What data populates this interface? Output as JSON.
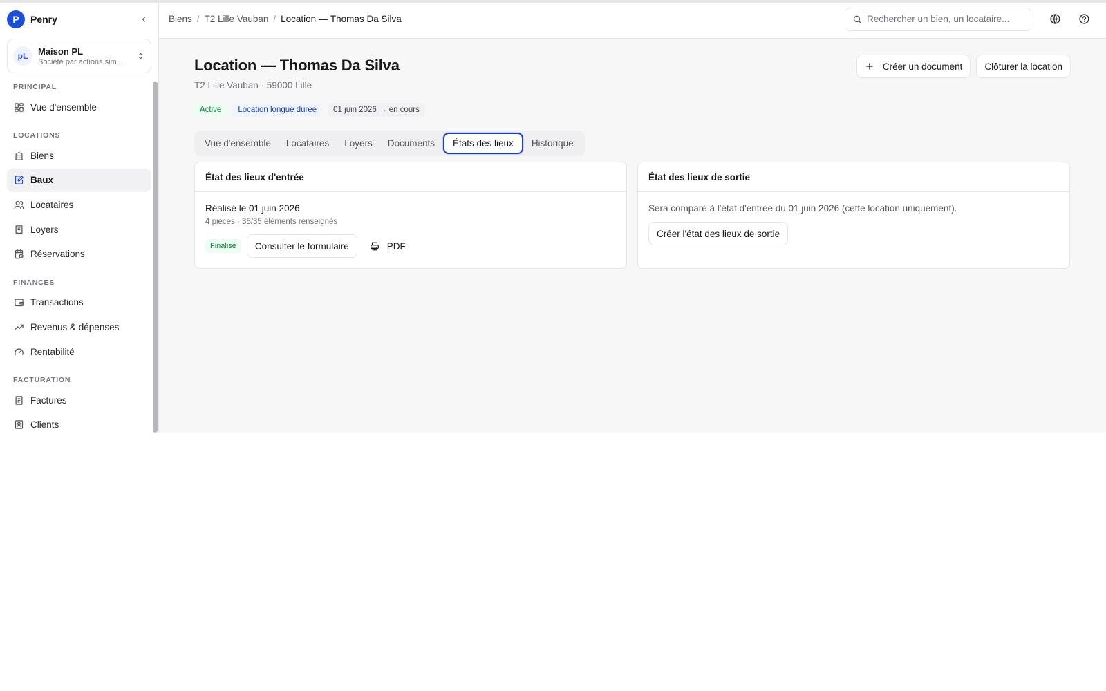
{
  "brand": {
    "logo_letter": "P",
    "name": "Penry"
  },
  "org": {
    "initials": "pL",
    "name": "Maison PL",
    "type": "Société par actions sim..."
  },
  "sidebar": {
    "sections": [
      {
        "title": "PRINCIPAL",
        "items": [
          {
            "label": "Vue d'ensemble",
            "icon": "dashboard-icon"
          }
        ]
      },
      {
        "title": "LOCATIONS",
        "items": [
          {
            "label": "Biens",
            "icon": "building-icon"
          },
          {
            "label": "Baux",
            "icon": "lease-edit-icon",
            "active": true
          },
          {
            "label": "Locataires",
            "icon": "users-icon"
          },
          {
            "label": "Loyers",
            "icon": "receipt-icon"
          },
          {
            "label": "Réservations",
            "icon": "calendar-clock-icon"
          }
        ]
      },
      {
        "title": "FINANCES",
        "items": [
          {
            "label": "Transactions",
            "icon": "wallet-icon"
          },
          {
            "label": "Revenus & dépenses",
            "icon": "trending-up-icon"
          },
          {
            "label": "Rentabilité",
            "icon": "gauge-icon"
          }
        ]
      },
      {
        "title": "FACTURATION",
        "items": [
          {
            "label": "Factures",
            "icon": "invoice-icon"
          },
          {
            "label": "Clients",
            "icon": "contact-icon"
          }
        ]
      }
    ]
  },
  "breadcrumb": [
    "Biens",
    "T2 Lille Vauban",
    "Location — Thomas Da Silva"
  ],
  "search": {
    "placeholder": "Rechercher un bien, un locataire..."
  },
  "page": {
    "title": "Location — Thomas Da Silva",
    "subtitle": "T2 Lille Vauban · 59000 Lille",
    "badges": {
      "status": "Active",
      "type": "Location longue durée",
      "period": "01 juin 2026 → en cours"
    },
    "actions": {
      "create_doc": "Créer un document",
      "close_lease": "Clôturer la location"
    }
  },
  "tabs": [
    {
      "label": "Vue d'ensemble"
    },
    {
      "label": "Locataires"
    },
    {
      "label": "Loyers"
    },
    {
      "label": "Documents"
    },
    {
      "label": "États des lieux",
      "active": true
    },
    {
      "label": "Historique"
    }
  ],
  "entry_card": {
    "title": "État des lieux d'entrée",
    "done": "Réalisé le 01 juin 2026",
    "meta": "4 pièces · 35/35 éléments renseignés",
    "status": "Finalisé",
    "view_form": "Consulter le formulaire",
    "pdf": "PDF"
  },
  "exit_card": {
    "title": "État des lieux de sortie",
    "description": "Sera comparé à l'état d'entrée du 01 juin 2026 (cette location uniquement).",
    "create": "Créer l'état des lieux de sortie"
  },
  "colors": {
    "brand": "#1d4ed8",
    "active_tab_border": "#1e40af",
    "success": "#15803d",
    "info": "#1e40af"
  }
}
